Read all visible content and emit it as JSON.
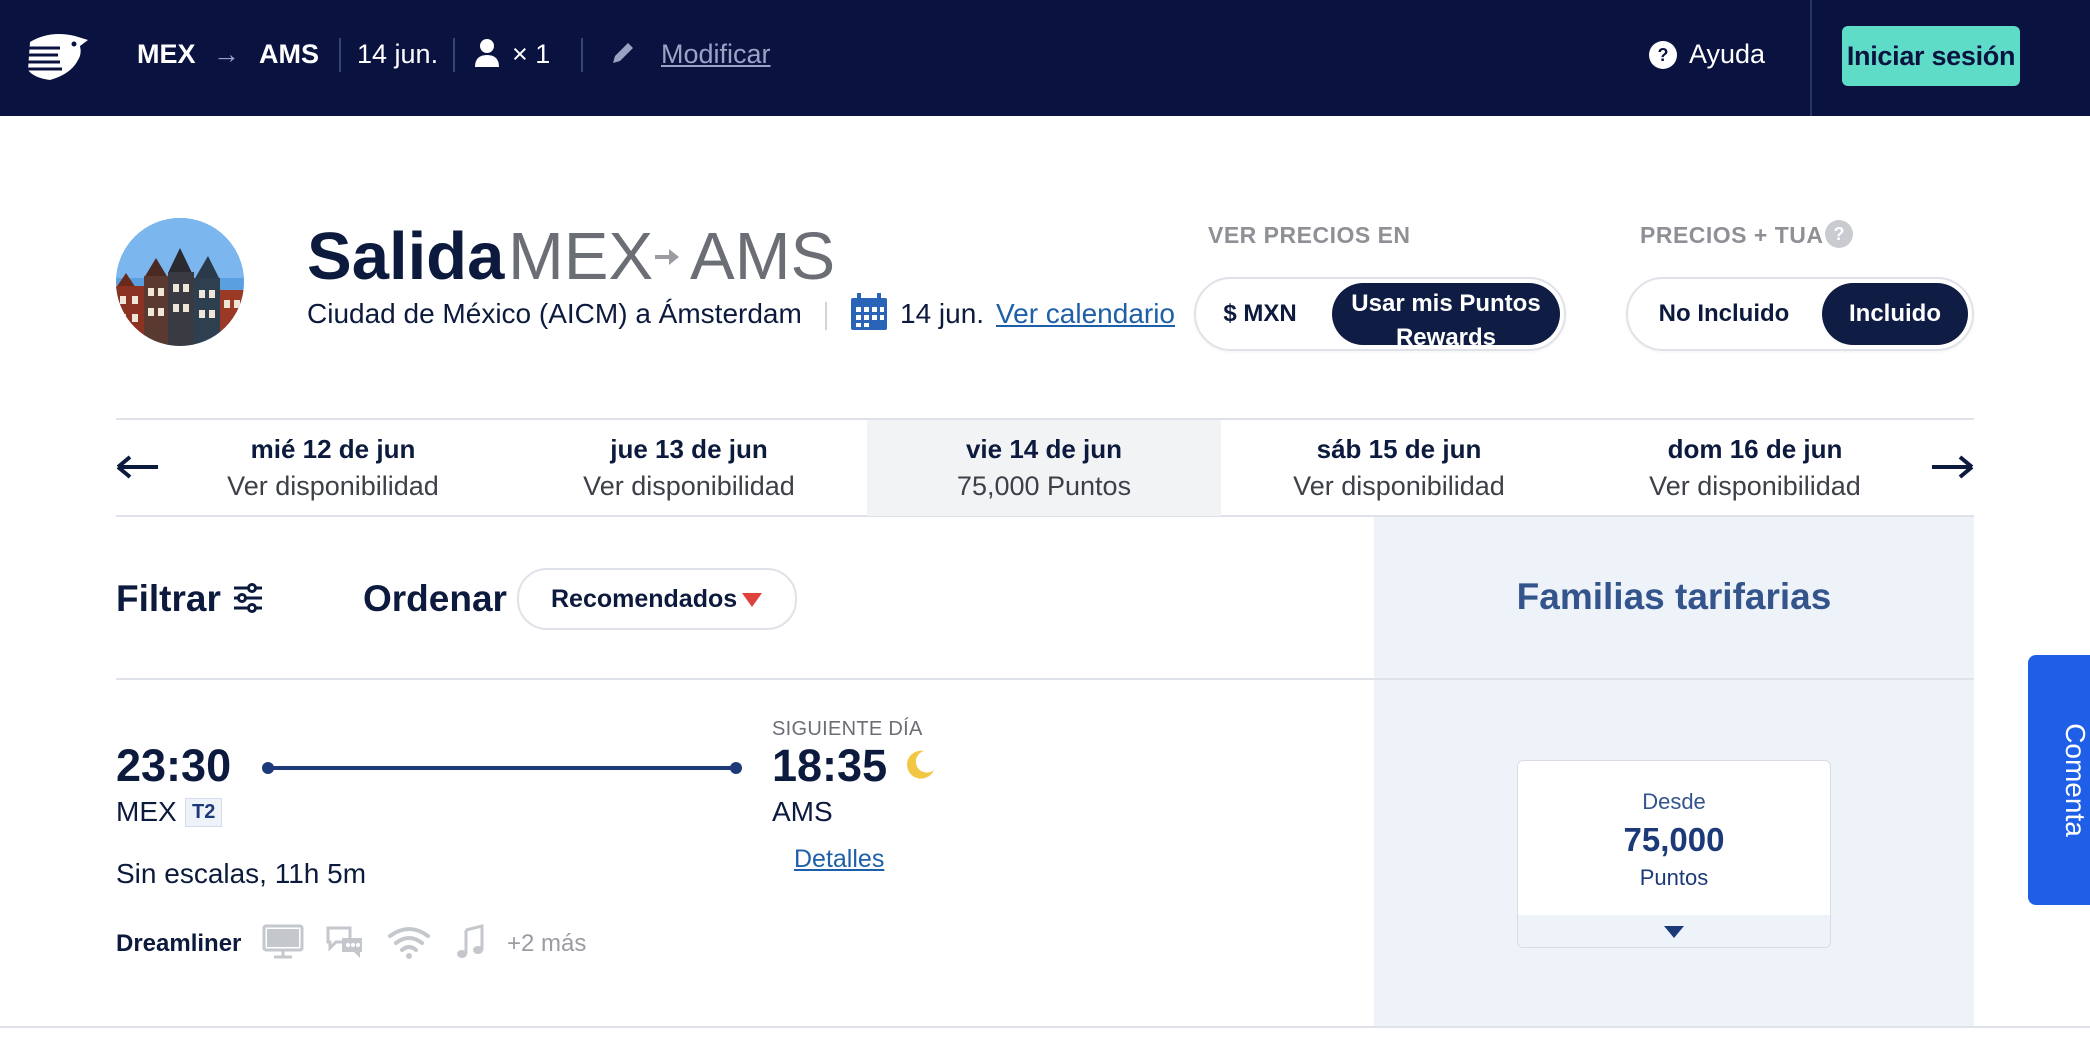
{
  "topbar": {
    "origin": "MEX",
    "arrow": "→",
    "destination": "AMS",
    "date": "14 jun.",
    "passengers": "× 1",
    "modify": "Modificar",
    "help": "Ayuda",
    "login": "Iniciar sesión"
  },
  "header": {
    "title": "Salida",
    "origin_code": "MEX",
    "destination_code": "AMS",
    "route_desc": "Ciudad de México (AICM) a Ámsterdam",
    "date": "14 jun.",
    "calendar_link": "Ver calendario"
  },
  "price_view": {
    "label": "VER PRECIOS EN",
    "options": [
      "$ MXN",
      "Usar mis Puntos Rewards"
    ],
    "selected": "Usar mis Puntos Rewards"
  },
  "tua": {
    "label": "PRECIOS + TUA",
    "options": [
      "No Incluido",
      "Incluido"
    ],
    "selected": "Incluido"
  },
  "dates": [
    {
      "day": "mié 12 de jun",
      "status": "Ver disponibilidad"
    },
    {
      "day": "jue 13 de jun",
      "status": "Ver disponibilidad"
    },
    {
      "day": "vie 14 de jun",
      "status": "75,000 Puntos",
      "selected": true
    },
    {
      "day": "sáb 15 de jun",
      "status": "Ver disponibilidad"
    },
    {
      "day": "dom 16 de jun",
      "status": "Ver disponibilidad"
    }
  ],
  "toolbar": {
    "filter": "Filtrar",
    "sort_label": "Ordenar",
    "sort_value": "Recomendados",
    "families": "Familias tarifarias"
  },
  "flight": {
    "dep_time": "23:30",
    "dep_airport": "MEX",
    "dep_terminal": "T2",
    "next_day": "SIGUIENTE DÍA",
    "arr_time": "18:35",
    "arr_airport": "AMS",
    "details": "Detalles",
    "duration": "Sin escalas, 11h 5m",
    "aircraft": "Dreamliner",
    "more": "+2 más",
    "amenities": [
      "monitor-icon",
      "chat-icon",
      "wifi-icon",
      "music-icon"
    ]
  },
  "fare": {
    "from": "Desde",
    "amount": "75,000",
    "unit": "Puntos"
  },
  "feedback": "Comenta",
  "colors": {
    "navy": "#0a1240",
    "teal": "#5fdcc7",
    "blue": "#1f5fe8",
    "link": "#1d5fa8",
    "panel": "#eef3f9"
  }
}
